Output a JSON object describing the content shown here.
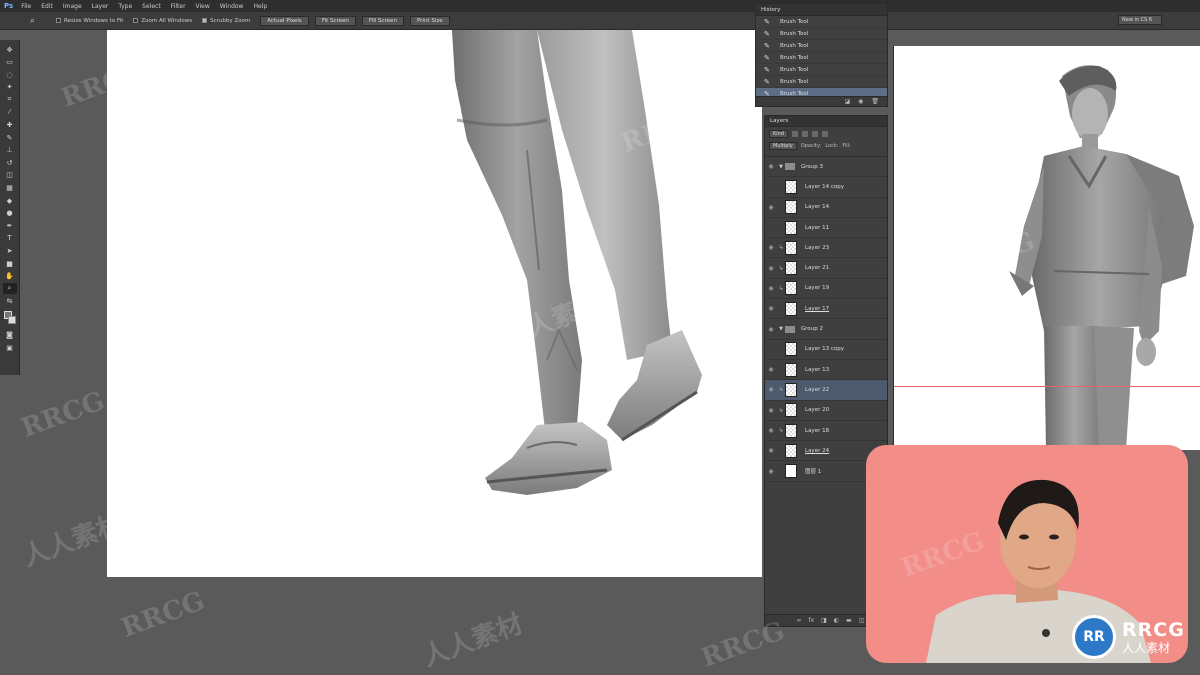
{
  "menubar": {
    "app_logo": "Ps",
    "items": [
      "File",
      "Edit",
      "Image",
      "Layer",
      "Type",
      "Select",
      "Filter",
      "View",
      "Window",
      "Help"
    ]
  },
  "options": {
    "resize_windows_label": "Resize Windows to Fit",
    "zoom_all_label": "Zoom All Windows",
    "scrubby_zoom_label": "Scrubby Zoom",
    "actual_pixels_label": "Actual Pixels",
    "fit_screen_label": "Fit Screen",
    "fill_screen_label": "Fill Screen",
    "print_size_label": "Print Size",
    "workspace_label": "New in CS 6"
  },
  "history": {
    "tab_label": "History",
    "items": [
      "Brush Tool",
      "Brush Tool",
      "Brush Tool",
      "Brush Tool",
      "Brush Tool",
      "Brush Tool",
      "Brush Tool"
    ]
  },
  "layers": {
    "tab_label": "Layers",
    "kind_label": "Kind",
    "blend_mode": "Multiply",
    "opacity_label": "Opacity:",
    "lock_label": "Lock:",
    "fill_label": "Fill:",
    "rows": [
      {
        "name": "Group 3",
        "type": "group"
      },
      {
        "name": "Layer 14 copy",
        "type": "layer"
      },
      {
        "name": "Layer 14",
        "type": "layer"
      },
      {
        "name": "Layer 11",
        "type": "layer"
      },
      {
        "name": "Layer 23",
        "type": "clipped"
      },
      {
        "name": "Layer 21",
        "type": "clipped"
      },
      {
        "name": "Layer 19",
        "type": "clipped"
      },
      {
        "name": "Layer 17",
        "type": "layer"
      },
      {
        "name": "Group 2",
        "type": "group"
      },
      {
        "name": "Layer 13 copy",
        "type": "layer"
      },
      {
        "name": "Layer 13",
        "type": "layer"
      },
      {
        "name": "Layer 22",
        "type": "clipped"
      },
      {
        "name": "Layer 20",
        "type": "clipped"
      },
      {
        "name": "Layer 18",
        "type": "clipped"
      },
      {
        "name": "Layer 24",
        "type": "layer"
      },
      {
        "name": "图层 1",
        "type": "layer"
      }
    ]
  },
  "watermarks": {
    "latin": "RRCG",
    "chinese": "人人素材"
  },
  "logo": {
    "badge": "RR",
    "title": "RRCG",
    "subtitle": "人人素材"
  }
}
